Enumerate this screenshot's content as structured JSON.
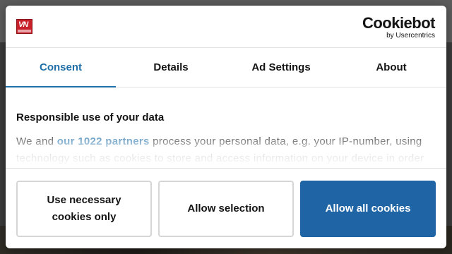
{
  "banner": {
    "brand_name": "Cookiebot",
    "brand_sub": "by Usercentrics",
    "site_logo_text": "VN"
  },
  "tabs": [
    {
      "label": "Consent",
      "active": true
    },
    {
      "label": "Details",
      "active": false
    },
    {
      "label": "Ad Settings",
      "active": false
    },
    {
      "label": "About",
      "active": false
    }
  ],
  "content": {
    "heading": "Responsible use of your data",
    "text_before_link": "We and ",
    "link_text": "our 1022 partners",
    "text_after_link": " process your personal data, e.g. your IP-number, using technology such as cookies to store and access information on your device in order"
  },
  "buttons": {
    "necessary": "Use necessary cookies only",
    "selection": "Allow selection",
    "all": "Allow all cookies"
  },
  "colors": {
    "accent": "#1f6fa8",
    "primary_button": "#1f64a5",
    "outline_border": "#d6d6d6"
  }
}
